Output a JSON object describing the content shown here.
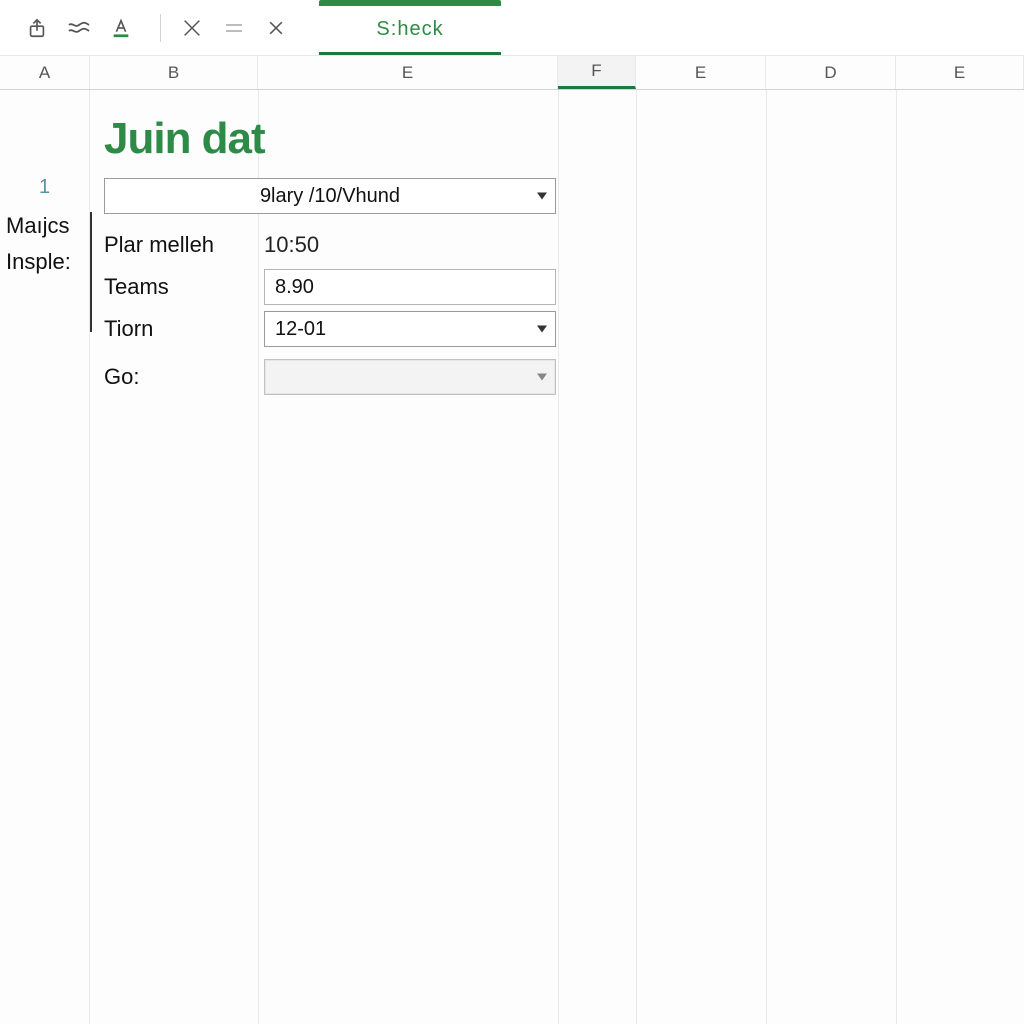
{
  "toolbar": {
    "active_tab_label": "S:heck"
  },
  "columns": [
    "A",
    "B",
    "E",
    "F",
    "E",
    "D",
    "E"
  ],
  "row_gutter": {
    "number": "1",
    "labels": [
      "Maıjcs",
      "Insple:"
    ]
  },
  "card": {
    "title": "Juin dat",
    "top_select": {
      "value": "9lary /10/Vhund"
    },
    "rows": [
      {
        "label": "Plar melleh",
        "value": "10:50",
        "type": "text"
      },
      {
        "label": "Teams",
        "value": "8.90",
        "type": "input"
      },
      {
        "label": "Tiorn",
        "value": "12-01",
        "type": "select"
      },
      {
        "label": "Go:",
        "value": "",
        "type": "select-disabled"
      }
    ]
  },
  "colors": {
    "accent": "#2e8b47"
  }
}
